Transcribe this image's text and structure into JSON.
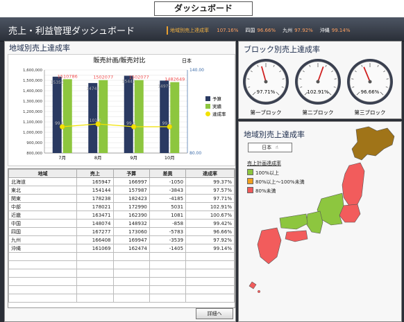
{
  "caption": "ダッシュボード",
  "header": {
    "title": "売上・利益管理ダッシュボード"
  },
  "ticker": {
    "label": "地域別売上達成率",
    "items": [
      {
        "name": "",
        "value": "107.16%"
      },
      {
        "name": "四国",
        "value": "96.66%"
      },
      {
        "name": "九州",
        "value": "97.92%"
      },
      {
        "name": "沖縄",
        "value": "99.14%"
      }
    ]
  },
  "left_panel": {
    "title": "地域別売上達成率"
  },
  "chart_data": {
    "type": "bar",
    "title": "販売計画/販売対比",
    "unit_label": "日本",
    "categories": [
      "7月",
      "8月",
      "9月",
      "10月"
    ],
    "series": [
      {
        "name": "予算",
        "color": "#2a3a62",
        "values": [
          1535000,
          1474000,
          1544000,
          1497000
        ],
        "labels": [
          "15350",
          "14743",
          "15442",
          "14973"
        ]
      },
      {
        "name": "実績",
        "color": "#8dc63f",
        "values": [
          1510786,
          1502077,
          1502077,
          1482649
        ],
        "labels": [
          "1510786",
          "1502077",
          "1502077",
          "1482649"
        ]
      },
      {
        "name": "達成率",
        "color": "#f2e200",
        "values": [
          99.0,
          101.0,
          99.0,
          99.0
        ],
        "labels": [
          "99.6",
          "101.6",
          "99.6",
          "99.6"
        ]
      }
    ],
    "y_left": {
      "min": 800000,
      "max": 1600000,
      "ticks": [
        "800,000",
        "900,000",
        "1,000,000",
        "1,100,000",
        "1,200,000",
        "1,300,000",
        "1,400,000",
        "1,500,000",
        "1,600,000"
      ]
    },
    "y_right": {
      "min": 80.0,
      "max": 140.0,
      "ticks": [
        "80.00",
        "140.00"
      ]
    },
    "grid": true,
    "legend": "right"
  },
  "table": {
    "headers": [
      "地域",
      "売上",
      "予算",
      "差異",
      "達成率"
    ],
    "rows": [
      [
        "北海道",
        "165947",
        "166997",
        "-1050",
        "99.37%"
      ],
      [
        "東北",
        "154144",
        "157987",
        "-3843",
        "97.57%"
      ],
      [
        "関東",
        "178238",
        "182423",
        "-4185",
        "97.71%"
      ],
      [
        "中部",
        "178021",
        "172990",
        "5031",
        "102.91%"
      ],
      [
        "近畿",
        "163471",
        "162390",
        "1081",
        "100.67%"
      ],
      [
        "中国",
        "148074",
        "148932",
        "-858",
        "99.42%"
      ],
      [
        "四国",
        "167277",
        "173060",
        "-5783",
        "96.66%"
      ],
      [
        "九州",
        "166408",
        "169947",
        "-3539",
        "97.92%"
      ],
      [
        "沖縄",
        "161069",
        "162474",
        "-1405",
        "99.14%"
      ]
    ],
    "empty_rows": 6,
    "detail_button": "詳細へ"
  },
  "block_panel": {
    "title": "ブロック別売上達成率",
    "gauges": [
      {
        "label": "第一ブロック",
        "value_text": "97.71%",
        "value": 97.71
      },
      {
        "label": "第二ブロック",
        "value_text": "102.91%",
        "value": 102.91
      },
      {
        "label": "第三ブロック",
        "value_text": "96.66%",
        "value": 96.66
      }
    ]
  },
  "map_panel": {
    "title": "地域別売上達成率",
    "selector": "日本",
    "legend_title": "売上計画達成率",
    "legend": [
      {
        "label": "100%以上",
        "color": "#8dc63f"
      },
      {
        "label": "80%以上～100%未満",
        "color": "#f0a020"
      },
      {
        "label": "80%未満",
        "color": "#f05a5a"
      }
    ],
    "colors": {
      "hokkaido": "#a07418",
      "honshu_red": "#f25c5c",
      "green": "#8dc63f"
    }
  }
}
